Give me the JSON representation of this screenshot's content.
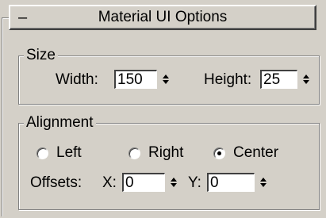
{
  "rollout": {
    "collapse_symbol": "–",
    "title": "Material UI Options"
  },
  "size_group": {
    "label": "Size",
    "width_label": "Width:",
    "width_value": "150",
    "height_label": "Height:",
    "height_value": "25"
  },
  "alignment_group": {
    "label": "Alignment",
    "options": [
      {
        "label": "Left",
        "checked": false
      },
      {
        "label": "Right",
        "checked": false
      },
      {
        "label": "Center",
        "checked": true
      }
    ],
    "offsets_label": "Offsets:",
    "x_label": "X:",
    "x_value": "0",
    "y_label": "Y:",
    "y_value": "0"
  },
  "icons": {
    "collapse": "minus-icon",
    "spinner": "spinner-arrows-icon",
    "radio": "radio-button-icon"
  },
  "colors": {
    "panel_background": "#d4d0c8",
    "field_background": "#ffffff"
  }
}
